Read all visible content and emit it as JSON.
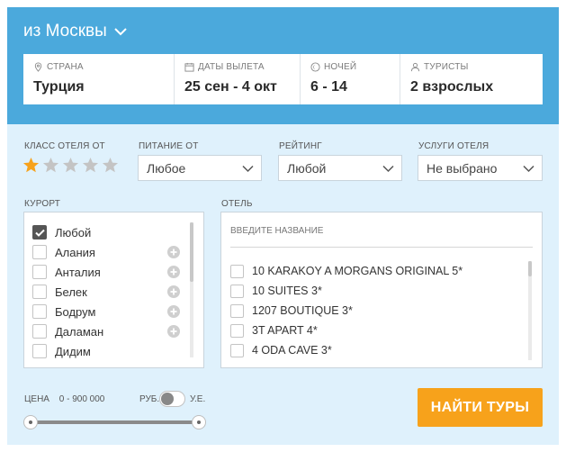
{
  "colors": {
    "topband": "#4ba9dc",
    "panel": "#dff1fc",
    "star_active": "#f7a21b",
    "star_inactive": "#c4c4c4",
    "button": "#f7a21b"
  },
  "header": {
    "departure_city": "из Москвы"
  },
  "search_params": [
    {
      "label": "Страна",
      "value": "Турция",
      "icon": "location-pin-icon"
    },
    {
      "label": "Даты вылета",
      "value": "25 сен - 4 окт",
      "icon": "calendar-icon"
    },
    {
      "label": "Ночей",
      "value": "6 - 14",
      "icon": "moon-icon"
    },
    {
      "label": "Туристы",
      "value": "2 взрослых",
      "icon": "person-icon"
    }
  ],
  "filters": {
    "hotel_class": {
      "label": "Класс отеля от",
      "rating": 1,
      "max": 5
    },
    "meal": {
      "label": "Питание от",
      "value": "Любое"
    },
    "rating": {
      "label": "Рейтинг",
      "value": "Любой"
    },
    "services": {
      "label": "Услуги отеля",
      "value": "Не выбрано"
    }
  },
  "resorts": {
    "label": "Курорт",
    "items": [
      {
        "name": "Любой",
        "checked": true,
        "expandable": false
      },
      {
        "name": "Алания",
        "checked": false,
        "expandable": true
      },
      {
        "name": "Анталия",
        "checked": false,
        "expandable": true
      },
      {
        "name": "Белек",
        "checked": false,
        "expandable": true
      },
      {
        "name": "Бодрум",
        "checked": false,
        "expandable": true
      },
      {
        "name": "Даламан",
        "checked": false,
        "expandable": true
      },
      {
        "name": "Дидим",
        "checked": false,
        "expandable": false
      }
    ]
  },
  "hotels": {
    "label": "Отель",
    "search_placeholder": "Введите название",
    "items": [
      "10 KARAKOY A MORGANS ORIGINAL 5*",
      "10 SUITES 3*",
      "1207 BOUTIQUE 3*",
      "3T APART 4*",
      "4 ODA CAVE 3*"
    ]
  },
  "price": {
    "label": "Цена",
    "min": "0",
    "max": "900 000",
    "range_text": "0 - 900 000",
    "currency_left": "руб.",
    "currency_right": "у.е."
  },
  "actions": {
    "find_tours": "Найти туры"
  }
}
